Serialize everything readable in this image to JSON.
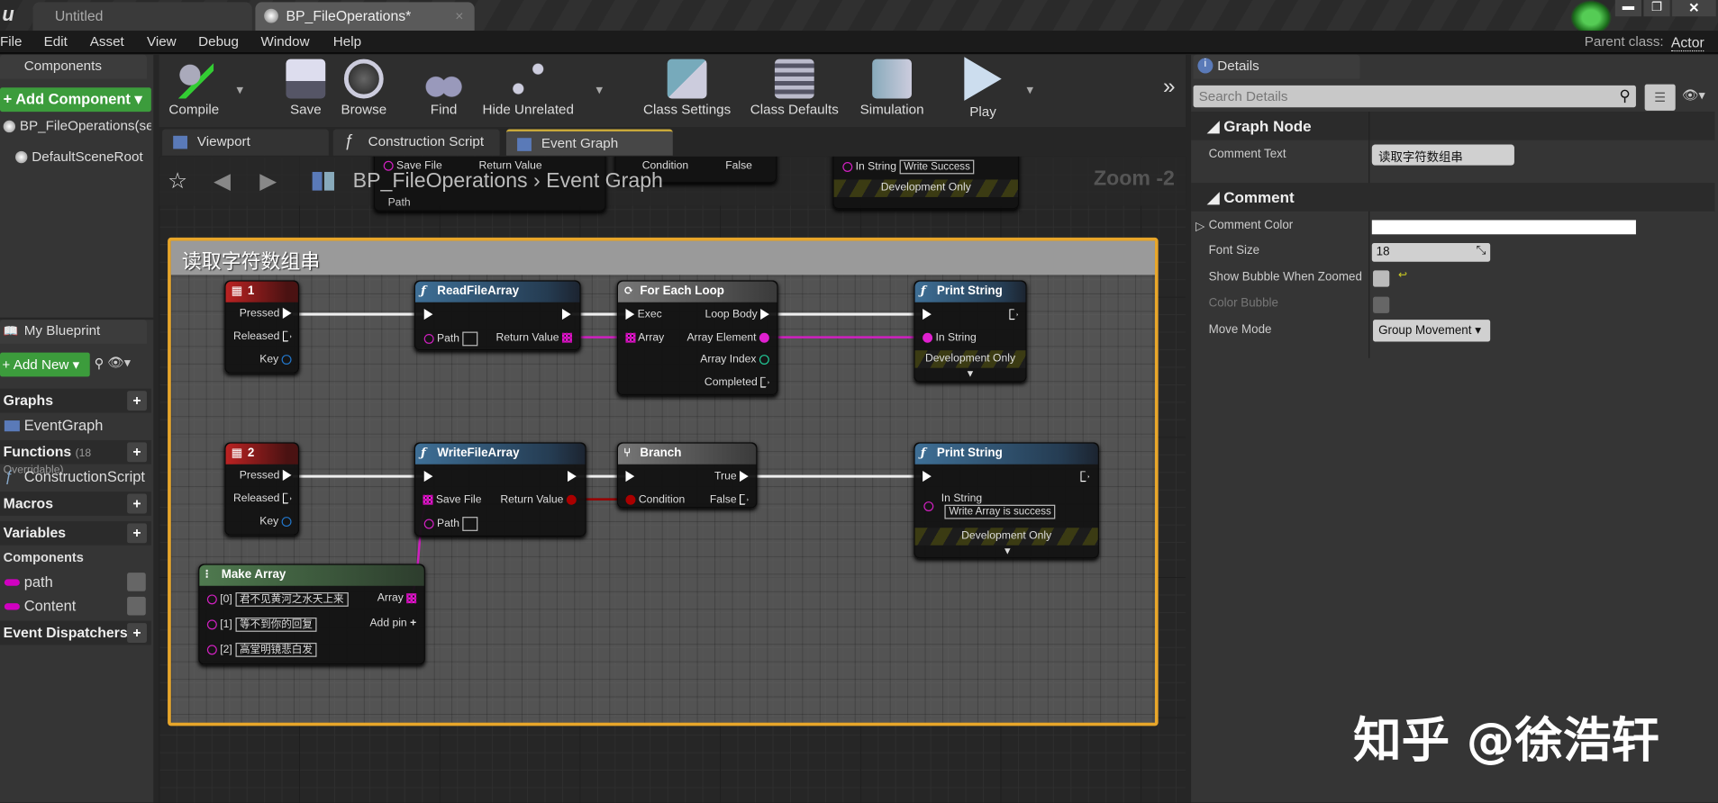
{
  "window": {
    "tabs": [
      {
        "label": "Untitled"
      },
      {
        "label": "BP_FileOperations*"
      }
    ],
    "parent_class_label": "Parent class:",
    "parent_class": "Actor"
  },
  "menu": [
    "File",
    "Edit",
    "Asset",
    "View",
    "Debug",
    "Window",
    "Help"
  ],
  "components_panel": {
    "title": "Components",
    "add_button": "Add Component",
    "items": [
      "BP_FileOperations(self)",
      "DefaultSceneRoot"
    ]
  },
  "toolbar": {
    "buttons": [
      "Compile",
      "Save",
      "Browse",
      "Find",
      "Hide Unrelated",
      "Class Settings",
      "Class Defaults",
      "Simulation",
      "Play"
    ]
  },
  "graph_tabs": [
    "Viewport",
    "Construction Script",
    "Event Graph"
  ],
  "breadcrumb": {
    "blueprint": "BP_FileOperations",
    "graph": "Event Graph",
    "zoom": "Zoom -2"
  },
  "my_blueprint": {
    "title": "My Blueprint",
    "add_new": "Add New",
    "graphs": "Graphs",
    "event_graph": "EventGraph",
    "functions": "Functions",
    "functions_note": "(18 Overridable)",
    "construction": "ConstructionScript",
    "macros": "Macros",
    "variables": "Variables",
    "components": "Components",
    "vars": [
      "path",
      "Content"
    ],
    "dispatchers": "Event Dispatchers"
  },
  "comment": {
    "title": "读取字符数组串"
  },
  "nodes": {
    "key1": {
      "title": "1",
      "pins": [
        "Pressed",
        "Released",
        "Key"
      ]
    },
    "read": {
      "title": "ReadFileArray",
      "pins": [
        "Path",
        "Return Value"
      ]
    },
    "foreach": {
      "title": "For Each Loop",
      "pins": [
        "Exec",
        "Array",
        "Loop Body",
        "Array Element",
        "Array Index",
        "Completed"
      ]
    },
    "print1": {
      "title": "Print String",
      "pins": [
        "In String"
      ],
      "dev": "Development Only"
    },
    "key2": {
      "title": "2",
      "pins": [
        "Pressed",
        "Released",
        "Key"
      ]
    },
    "write": {
      "title": "WriteFileArray",
      "pins": [
        "Save File",
        "Path",
        "Return Value"
      ]
    },
    "branch": {
      "title": "Branch",
      "pins": [
        "Condition",
        "True",
        "False"
      ]
    },
    "print2": {
      "title": "Print String",
      "pins": [
        "In String"
      ],
      "in_string": "Write Array is success",
      "dev": "Development Only"
    },
    "make": {
      "title": "Make Array",
      "pins": [
        "[0]",
        "[1]",
        "[2]",
        "Array",
        "Add pin"
      ],
      "values": [
        "君不见黄河之水天上来",
        "等不到你的回复",
        "高堂明镜悲白发"
      ]
    },
    "bg_partial": {
      "save_file": "Save File",
      "return_value": "Return Value",
      "path": "Path",
      "condition": "Condition",
      "false": "False",
      "in_string": "In String",
      "write_success": "Write Success",
      "dev": "Development Only"
    }
  },
  "details": {
    "title": "Details",
    "search_placeholder": "Search Details",
    "graph_node": "Graph Node",
    "comment_text_label": "Comment Text",
    "comment_text": "读取字符数组串",
    "comment_section": "Comment",
    "comment_color": "Comment Color",
    "comment_color_value": "#ffffff",
    "font_size_label": "Font Size",
    "font_size": "18",
    "show_bubble": "Show Bubble When Zoomed",
    "color_bubble": "Color Bubble",
    "move_mode": "Move Mode",
    "move_mode_value": "Group Movement"
  },
  "watermark": "知乎 @徐浩轩"
}
